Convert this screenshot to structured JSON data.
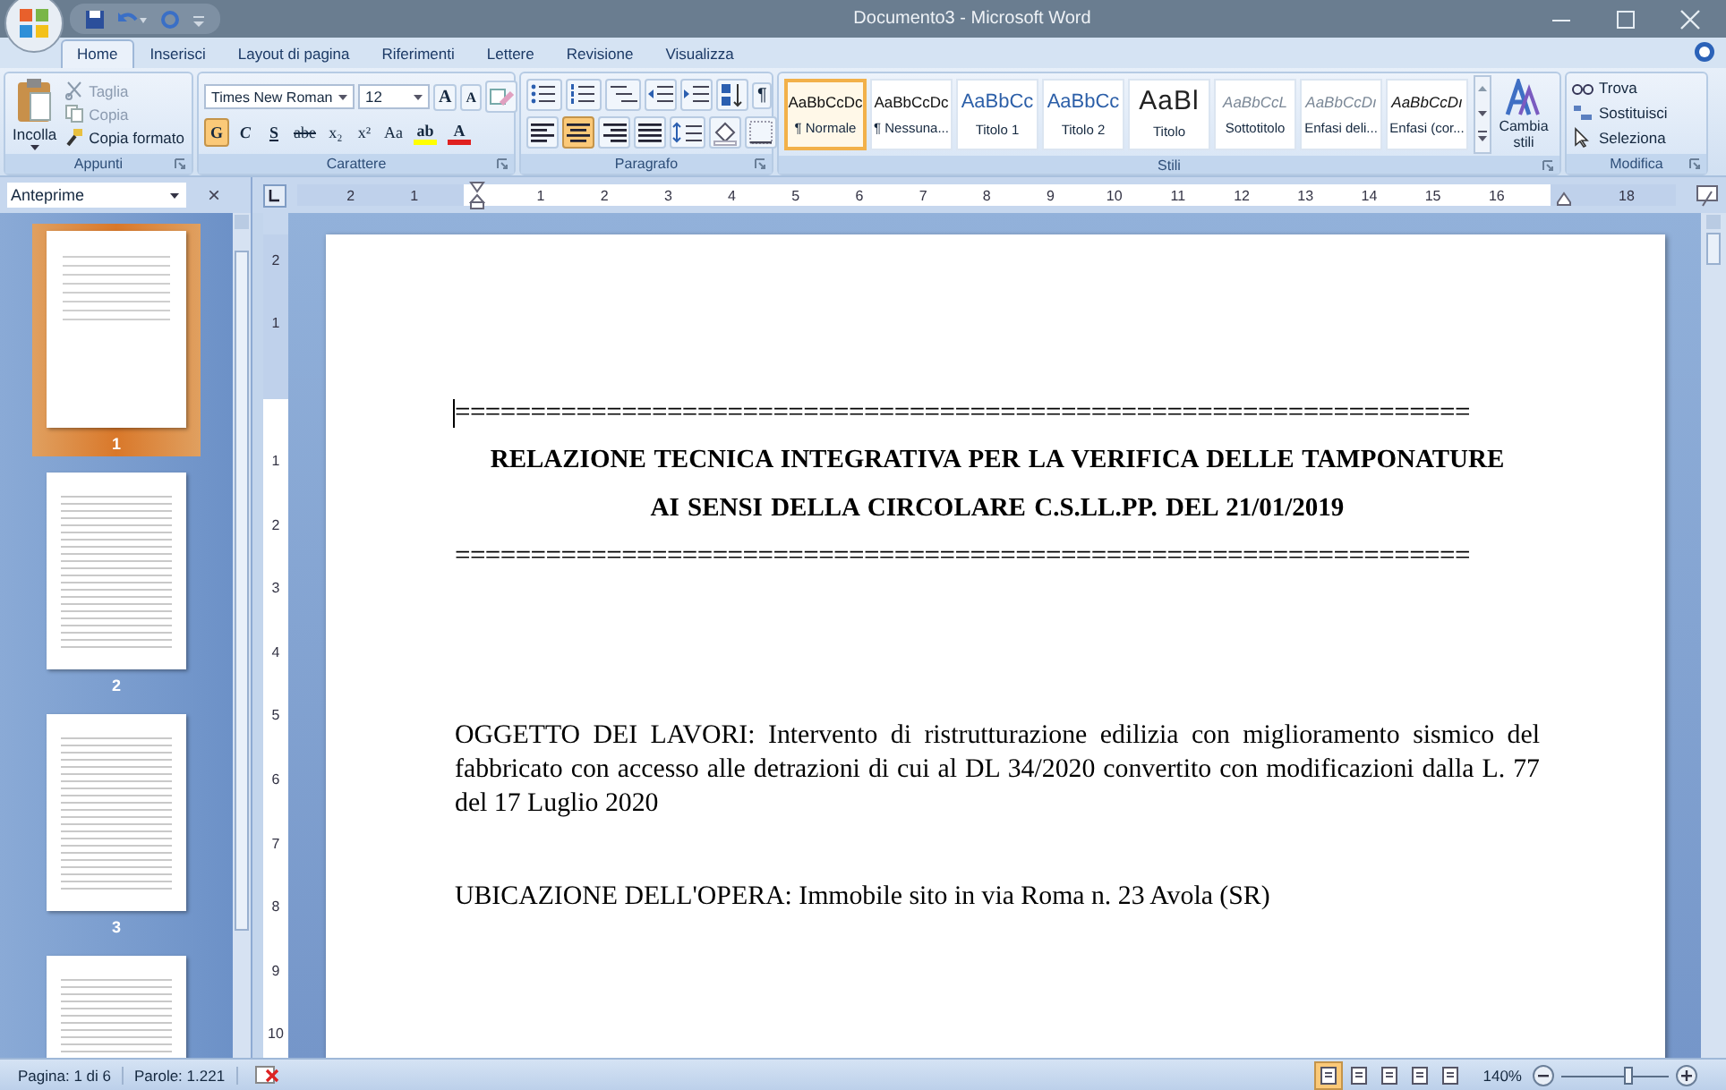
{
  "window": {
    "title": "Documento3 - Microsoft Word"
  },
  "tabs": [
    {
      "label": "Home",
      "selected": true
    },
    {
      "label": "Inserisci",
      "selected": false
    },
    {
      "label": "Layout di pagina",
      "selected": false
    },
    {
      "label": "Riferimenti",
      "selected": false
    },
    {
      "label": "Lettere",
      "selected": false
    },
    {
      "label": "Revisione",
      "selected": false
    },
    {
      "label": "Visualizza",
      "selected": false
    }
  ],
  "ribbon": {
    "clipboard": {
      "label": "Appunti",
      "paste": "Incolla",
      "items": [
        {
          "label": "Taglia",
          "disabled": true
        },
        {
          "label": "Copia",
          "disabled": true
        },
        {
          "label": "Copia formato",
          "disabled": false
        }
      ]
    },
    "font": {
      "label": "Carattere",
      "family": "Times New Roman",
      "size": "12",
      "size_buttons": [
        "A",
        "A"
      ],
      "format_buttons": [
        {
          "label": "G",
          "kind": "bold",
          "on": true
        },
        {
          "label": "C",
          "kind": "italic",
          "on": false
        },
        {
          "label": "S",
          "kind": "underline",
          "on": false
        },
        {
          "label": "abe",
          "kind": "strike",
          "on": false
        },
        {
          "label": "x₂",
          "kind": "plain",
          "on": false
        },
        {
          "label": "x²",
          "kind": "plain",
          "on": false
        },
        {
          "label": "Aa",
          "kind": "plain",
          "on": false
        }
      ],
      "color_buttons": [
        {
          "label": "ab",
          "color": "#ffff00"
        },
        {
          "label": "A",
          "color": "#e02020"
        }
      ]
    },
    "paragraph": {
      "label": "Paragrafo",
      "pilcrow": "¶",
      "align_buttons": [
        {
          "kind": "left",
          "selected": false
        },
        {
          "kind": "center",
          "selected": true
        },
        {
          "kind": "right",
          "selected": false
        },
        {
          "kind": "justify",
          "selected": false
        }
      ]
    },
    "styles": {
      "label": "Stili",
      "items": [
        {
          "preview": "AaBbCcDc",
          "name": "¶ Normale",
          "kind": "normal",
          "selected": true
        },
        {
          "preview": "AaBbCcDc",
          "name": "¶ Nessuna...",
          "kind": "normal",
          "selected": false
        },
        {
          "preview": "AaBbCc",
          "name": "Titolo 1",
          "kind": "heading",
          "selected": false
        },
        {
          "preview": "AaBbCc",
          "name": "Titolo 2",
          "kind": "heading",
          "selected": false
        },
        {
          "preview": "AaBl",
          "name": "Titolo",
          "kind": "title",
          "selected": false
        },
        {
          "preview": "AaBbCcL",
          "name": "Sottotitolo",
          "kind": "subtle",
          "selected": false
        },
        {
          "preview": "AaBbCcDı",
          "name": "Enfasi deli...",
          "kind": "subtle",
          "selected": false
        },
        {
          "preview": "AaBbCcDı",
          "name": "Enfasi (cor...",
          "kind": "emphasis",
          "selected": false
        }
      ],
      "change": "Cambia stili"
    },
    "editing": {
      "label": "Modifica",
      "items": [
        "Trova",
        "Sostituisci",
        "Seleziona"
      ]
    }
  },
  "pane": {
    "title": "Anteprime",
    "close": "×",
    "thumbnails": [
      {
        "number": "1",
        "selected": true
      },
      {
        "number": "2",
        "selected": false
      },
      {
        "number": "3",
        "selected": false
      },
      {
        "selected": false
      }
    ]
  },
  "ruler": {
    "left_labels": [
      "2",
      "1"
    ],
    "labels": [
      "1",
      "2",
      "3",
      "4",
      "5",
      "6",
      "7",
      "8",
      "9",
      "10",
      "11",
      "12",
      "13",
      "14",
      "15",
      "16"
    ],
    "end_labels": [
      "18"
    ]
  },
  "vertical_ruler": {
    "top_labels": [
      "2",
      "1"
    ],
    "labels": [
      "1",
      "2",
      "3",
      "4",
      "5",
      "6",
      "7",
      "8",
      "9",
      "10"
    ]
  },
  "document": {
    "blocks": [
      {
        "kind": "rule",
        "text": "==================================================================="
      },
      {
        "kind": "heading",
        "text": "RELAZIONE TECNICA INTEGRATIVA PER LA VERIFICA DELLE TAMPONATURE"
      },
      {
        "kind": "heading",
        "text": "AI SENSI DELLA CIRCOLARE C.S.LL.PP. DEL 21/01/2019"
      },
      {
        "kind": "rule",
        "text": "==================================================================="
      },
      {
        "kind": "paragraph",
        "text": "OGGETTO DEI LAVORI: Intervento di ristrutturazione edilizia con miglioramento sismico del fabbricato con accesso alle detrazioni di cui al DL 34/2020 convertito con modificazioni dalla L. 77 del 17 Luglio 2020"
      },
      {
        "kind": "paragraph",
        "text": "UBICAZIONE DELL'OPERA: Immobile sito in via Roma n. 23 Avola (SR)"
      }
    ]
  },
  "status_bar": {
    "page": "Pagina: 1 di 6",
    "words": "Parole: 1.221",
    "views": [
      {
        "selected": true
      },
      {
        "selected": false
      },
      {
        "selected": false
      },
      {
        "selected": false
      },
      {
        "selected": false
      }
    ],
    "zoom": "140%",
    "zoom_slider": {
      "level": 0.62
    }
  }
}
